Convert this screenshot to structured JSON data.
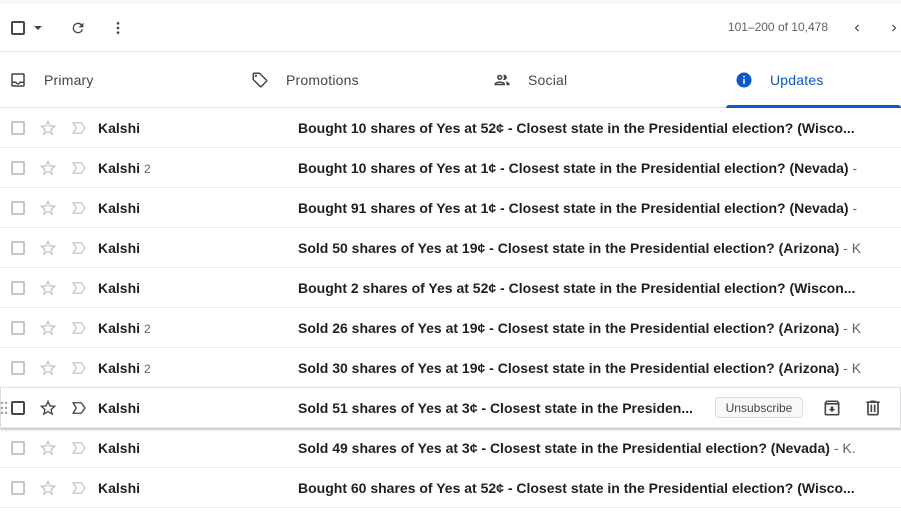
{
  "colors": {
    "accent": "#0b57d0",
    "text": "#1f1f1f",
    "muted": "#5f6368",
    "divider": "#eef0f2"
  },
  "toolbar": {
    "select_icon": "checkbox-icon",
    "select_menu_icon": "caret-down-icon",
    "refresh_icon": "refresh-icon",
    "more_icon": "more-vert-icon",
    "pagination": "101–200 of 10,478",
    "prev_icon": "chevron-left-icon",
    "next_icon": "chevron-right-icon"
  },
  "tabs": [
    {
      "label": "Primary",
      "icon": "inbox-icon",
      "selected": false
    },
    {
      "label": "Promotions",
      "icon": "tag-icon",
      "selected": false
    },
    {
      "label": "Social",
      "icon": "people-icon",
      "selected": false
    },
    {
      "label": "Updates",
      "icon": "info-icon",
      "selected": true
    }
  ],
  "emails": [
    {
      "sender": "Kalshi",
      "count": "",
      "subject": "Bought 10 shares of Yes at 52¢ - Closest state in the Presidential election? (Wisco...",
      "snippet": ""
    },
    {
      "sender": "Kalshi",
      "count": "2",
      "subject": "Bought 10 shares of Yes at 1¢ - Closest state in the Presidential election? (Nevada)",
      "snippet": " -"
    },
    {
      "sender": "Kalshi",
      "count": "",
      "subject": "Bought 91 shares of Yes at 1¢ - Closest state in the Presidential election? (Nevada)",
      "snippet": " -"
    },
    {
      "sender": "Kalshi",
      "count": "",
      "subject": "Sold 50 shares of Yes at 19¢ - Closest state in the Presidential election? (Arizona)",
      "snippet": " - K"
    },
    {
      "sender": "Kalshi",
      "count": "",
      "subject": "Bought 2 shares of Yes at 52¢ - Closest state in the Presidential election? (Wiscon...",
      "snippet": ""
    },
    {
      "sender": "Kalshi",
      "count": "2",
      "subject": "Sold 26 shares of Yes at 19¢ - Closest state in the Presidential election? (Arizona)",
      "snippet": " - K"
    },
    {
      "sender": "Kalshi",
      "count": "2",
      "subject": "Sold 30 shares of Yes at 19¢ - Closest state in the Presidential election? (Arizona)",
      "snippet": " - K"
    },
    {
      "sender": "Kalshi",
      "count": "",
      "subject": "Sold 51 shares of Yes at 3¢ - Closest state in the Presiden...",
      "snippet": "",
      "hovered": true,
      "unsubscribe": "Unsubscribe"
    },
    {
      "sender": "Kalshi",
      "count": "",
      "subject": "Sold 49 shares of Yes at 3¢ - Closest state in the Presidential election? (Nevada)",
      "snippet": " - K."
    },
    {
      "sender": "Kalshi",
      "count": "",
      "subject": "Bought 60 shares of Yes at 52¢ - Closest state in the Presidential election? (Wisco...",
      "snippet": ""
    }
  ]
}
